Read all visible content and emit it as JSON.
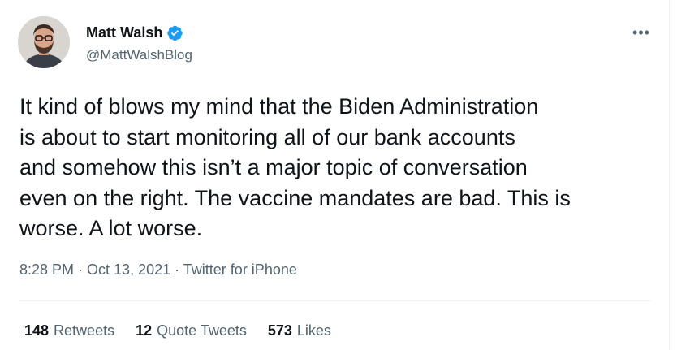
{
  "author": {
    "display_name": "Matt Walsh",
    "handle": "@MattWalshBlog",
    "verified_icon": "verified-badge-icon",
    "verified_color": "#1d9bf0"
  },
  "more_label": "•••",
  "tweet": {
    "text": "It kind of blows my mind that the Biden Administration\nis about to start monitoring all of our bank accounts\nand somehow this isn’t a major topic of conversation\neven on the right. The vaccine mandates are bad. This is\nworse. A lot worse."
  },
  "meta": {
    "time": "8:28 PM",
    "separator": " · ",
    "date": "Oct 13, 2021",
    "source": "Twitter for iPhone"
  },
  "stats": {
    "retweets_count": "148",
    "retweets_label": "Retweets",
    "quotes_count": "12",
    "quotes_label": "Quote Tweets",
    "likes_count": "573",
    "likes_label": "Likes"
  }
}
